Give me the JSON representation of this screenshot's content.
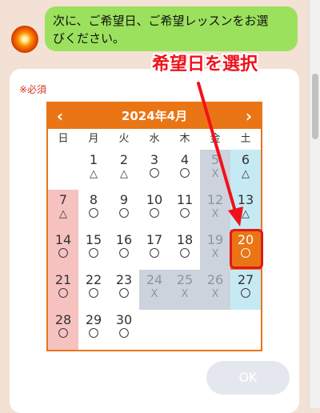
{
  "chat": {
    "message_line1": "次に、ご希望日、ご希望レッスンをお選",
    "message_line2": "びください。"
  },
  "form": {
    "required_label": "※必須",
    "ok_label": "OK"
  },
  "calendar": {
    "title": "2024年4月",
    "prev_icon": "‹",
    "next_icon": "›",
    "weekdays": [
      "日",
      "月",
      "火",
      "水",
      "木",
      "金",
      "土"
    ],
    "rows": [
      [
        {
          "day": "",
          "mark": ""
        },
        {
          "day": "1",
          "mark": "△"
        },
        {
          "day": "2",
          "mark": "△"
        },
        {
          "day": "3",
          "mark": "〇"
        },
        {
          "day": "4",
          "mark": "〇"
        },
        {
          "day": "5",
          "mark": "X"
        },
        {
          "day": "6",
          "mark": "△"
        }
      ],
      [
        {
          "day": "7",
          "mark": "△"
        },
        {
          "day": "8",
          "mark": "〇"
        },
        {
          "day": "9",
          "mark": "〇"
        },
        {
          "day": "10",
          "mark": "〇"
        },
        {
          "day": "11",
          "mark": "〇"
        },
        {
          "day": "12",
          "mark": "X"
        },
        {
          "day": "13",
          "mark": "△"
        }
      ],
      [
        {
          "day": "14",
          "mark": "〇"
        },
        {
          "day": "15",
          "mark": "〇"
        },
        {
          "day": "16",
          "mark": "〇"
        },
        {
          "day": "17",
          "mark": "〇"
        },
        {
          "day": "18",
          "mark": "〇"
        },
        {
          "day": "19",
          "mark": "X"
        },
        {
          "day": "20",
          "mark": "〇"
        }
      ],
      [
        {
          "day": "21",
          "mark": "〇"
        },
        {
          "day": "22",
          "mark": "〇"
        },
        {
          "day": "23",
          "mark": "〇"
        },
        {
          "day": "24",
          "mark": "X"
        },
        {
          "day": "25",
          "mark": "X"
        },
        {
          "day": "26",
          "mark": "X"
        },
        {
          "day": "27",
          "mark": "〇"
        }
      ],
      [
        {
          "day": "28",
          "mark": "〇"
        },
        {
          "day": "29",
          "mark": "〇"
        },
        {
          "day": "30",
          "mark": "〇"
        },
        {
          "day": "",
          "mark": ""
        },
        {
          "day": "",
          "mark": ""
        },
        {
          "day": "",
          "mark": ""
        },
        {
          "day": "",
          "mark": ""
        }
      ]
    ],
    "selected_day": "20"
  },
  "annotation": {
    "text": "希望日を選択"
  },
  "colors": {
    "accent": "#ea7514",
    "bubble": "#9be15d",
    "highlight": "#e0181b"
  }
}
